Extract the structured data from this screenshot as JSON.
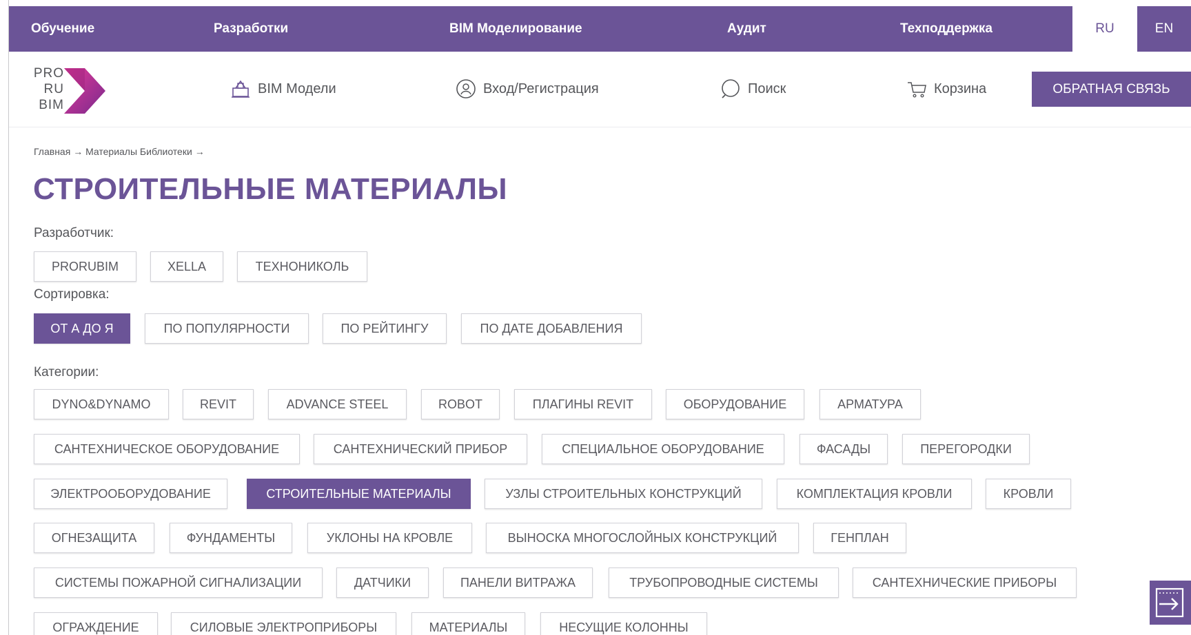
{
  "topnav": {
    "items": [
      "Обучение",
      "Разработки",
      "BIM Моделирование",
      "Аудит",
      "Техподдержка"
    ],
    "lang_ru": "RU",
    "lang_en": "EN"
  },
  "header": {
    "logo_lines": [
      "PRO",
      "RU",
      "BIM"
    ],
    "bim_models": "BIM Модели",
    "login": "Вход/Регистрация",
    "search": "Поиск",
    "cart": "Корзина",
    "feedback": "ОБРАТНАЯ СВЯЗЬ"
  },
  "breadcrumb": {
    "home": "Главная",
    "arrow": "→",
    "library": "Материалы Библиотеки"
  },
  "page_title": "СТРОИТЕЛЬНЫЕ МАТЕРИАЛЫ",
  "filters": {
    "developer_label": "Разработчик:",
    "developers": [
      "PRORUBIM",
      "XELLA",
      "ТЕХНОНИКОЛЬ"
    ],
    "sort_label": "Сортировка:",
    "sort_options": [
      "ОТ А ДО Я",
      "ПО ПОПУЛЯРНОСТИ",
      "ПО РЕЙТИНГУ",
      "ПО ДАТЕ ДОБАВЛЕНИЯ"
    ],
    "sort_selected": "ОТ А ДО Я",
    "categories_label": "Категории:",
    "categories": [
      "DYNO&DYNAMO",
      "REVIT",
      "ADVANCE STEEL",
      "ROBOT",
      "ПЛАГИНЫ REVIT",
      "ОБОРУДОВАНИЕ",
      "АРМАТУРА",
      "САНТЕХНИЧЕСКОЕ ОБОРУДОВАНИЕ",
      "САНТЕХНИЧЕСКИЙ ПРИБОР",
      "СПЕЦИАЛЬНОЕ ОБОРУДОВАНИЕ",
      "ФАСАДЫ",
      "ПЕРЕГОРОДКИ",
      "ЭЛЕКТРООБОРУДОВАНИЕ",
      "СТРОИТЕЛЬНЫЕ МАТЕРИАЛЫ",
      "УЗЛЫ СТРОИТЕЛЬНЫХ КОНСТРУКЦИЙ",
      "КОМПЛЕКТАЦИЯ КРОВЛИ",
      "КРОВЛИ",
      "ОГНЕЗАЩИТА",
      "ФУНДАМЕНТЫ",
      "УКЛОНЫ НА КРОВЛЕ",
      "ВЫНОСКА МНОГОСЛОЙНЫХ КОНСТРУКЦИЙ",
      "ГЕНПЛАН",
      "СИСТЕМЫ ПОЖАРНОЙ СИГНАЛИЗАЦИИ",
      "ДАТЧИКИ",
      "ПАНЕЛИ ВИТРАЖА",
      "ТРУБОПРОВОДНЫЕ СИСТЕМЫ",
      "САНТЕХНИЧЕСКИЕ ПРИБОРЫ",
      "ОГРАЖДЕНИЕ",
      "СИЛОВЫЕ ЭЛЕКТРОПРИБОРЫ",
      "МАТЕРИАЛЫ",
      "НЕСУЩИЕ КОЛОННЫ"
    ],
    "category_selected": "СТРОИТЕЛЬНЫЕ МАТЕРИАЛЫ"
  },
  "colors": {
    "brand": "#6b5497",
    "logo_magenta": "#c2228a",
    "text": "#55565a"
  },
  "icons": {
    "bim_models": "building-icon",
    "login": "user-circle-icon",
    "search": "search-icon",
    "cart": "cart-icon",
    "fab": "exit-arrow-icon"
  }
}
